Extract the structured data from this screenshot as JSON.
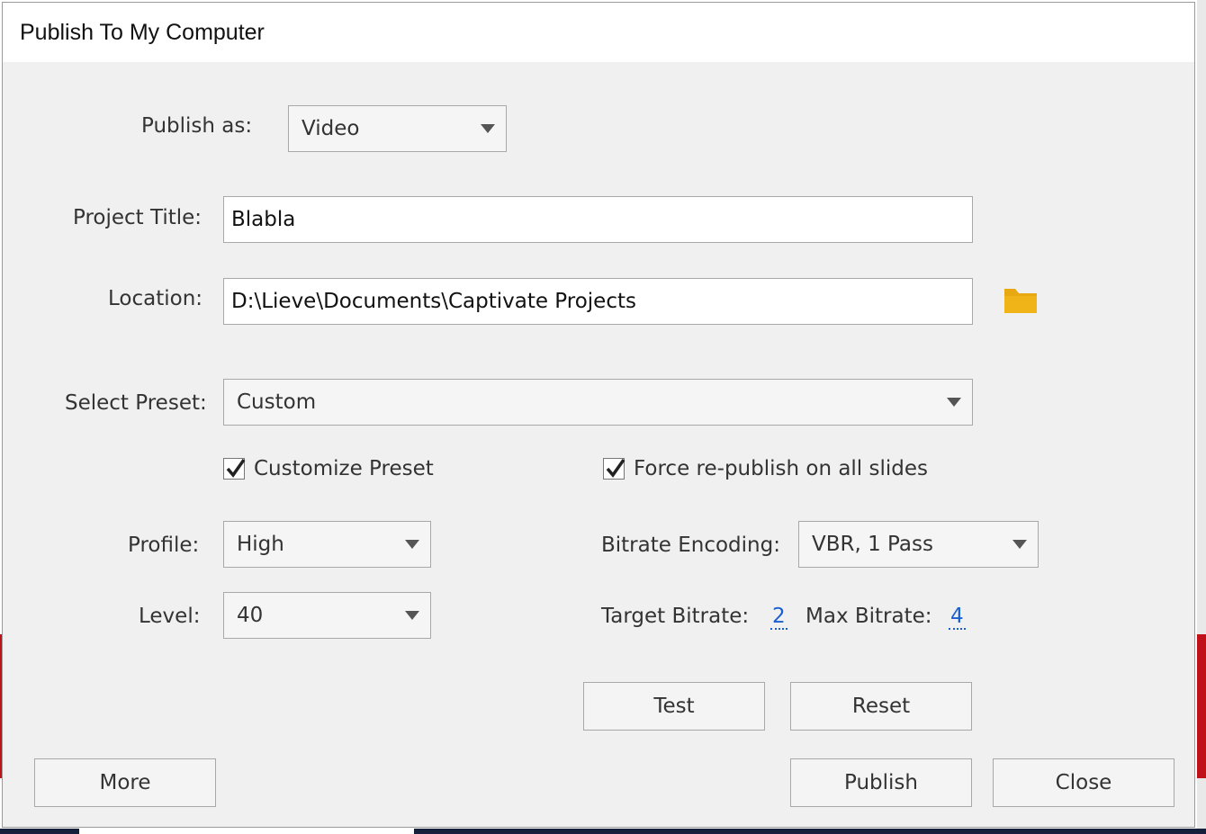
{
  "dialog": {
    "title": "Publish To My Computer"
  },
  "form": {
    "publish_as": {
      "label": "Publish as:",
      "value": "Video"
    },
    "project_title": {
      "label": "Project Title:",
      "value": "Blabla"
    },
    "location": {
      "label": "Location:",
      "value": "D:\\Lieve\\Documents\\Captivate Projects"
    },
    "select_preset": {
      "label": "Select Preset:",
      "value": "Custom"
    },
    "customize_preset": {
      "label": "Customize Preset",
      "checked": true
    },
    "force_republish": {
      "label": "Force re-publish on all slides",
      "checked": true
    },
    "profile": {
      "label": "Profile:",
      "value": "High"
    },
    "level": {
      "label": "Level:",
      "value": "40"
    },
    "bitrate_encoding": {
      "label": "Bitrate Encoding:",
      "value": "VBR, 1 Pass"
    },
    "target_bitrate": {
      "label": "Target Bitrate:",
      "value": "2"
    },
    "max_bitrate": {
      "label": "Max Bitrate:",
      "value": "4"
    }
  },
  "buttons": {
    "test": "Test",
    "reset": "Reset",
    "more": "More",
    "publish": "Publish",
    "close": "Close"
  },
  "icons": {
    "folder": "folder-icon",
    "caret": "chevron-down-icon",
    "check": "checkmark-icon"
  },
  "colors": {
    "folder": "#e8a812",
    "link": "#1a5fd1",
    "dialog_bg": "#f0f0f0"
  }
}
